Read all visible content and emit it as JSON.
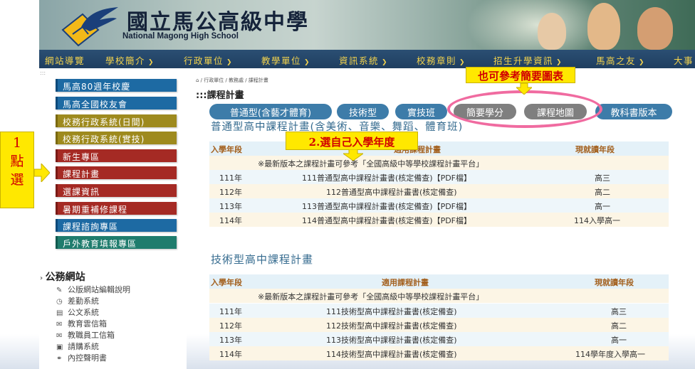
{
  "header": {
    "school_name_cn": "國立馬公高級中學",
    "school_name_en": "National Magong High School"
  },
  "nav": {
    "items": [
      {
        "label": "網站導覽"
      },
      {
        "label": "學校簡介"
      },
      {
        "label": "行政單位"
      },
      {
        "label": "教學單位"
      },
      {
        "label": "資訊系統"
      },
      {
        "label": "校務章則"
      },
      {
        "label": "招生升學資訊"
      },
      {
        "label": "馬高之友"
      },
      {
        "label": "大事"
      }
    ]
  },
  "sidebar": {
    "items": [
      {
        "label": "馬高80週年校慶"
      },
      {
        "label": "馬高全國校友會"
      },
      {
        "label": "校務行政系統(日間)"
      },
      {
        "label": "校務行政系統(實技)"
      },
      {
        "label": "新生專區"
      },
      {
        "label": "課程計畫"
      },
      {
        "label": "選課資訊"
      },
      {
        "label": "暑期重補修課程"
      },
      {
        "label": "課程諮詢專區"
      },
      {
        "label": "戶外教育填報專區"
      }
    ],
    "gov_title": "公務網站",
    "gov_links": [
      {
        "label": "公版網站編輯說明",
        "icon": "edit-icon"
      },
      {
        "label": "差勤系統",
        "icon": "clock-icon"
      },
      {
        "label": "公文系統",
        "icon": "document-icon"
      },
      {
        "label": "教育雲信箱",
        "icon": "mail-icon"
      },
      {
        "label": "教職員工信箱",
        "icon": "envelope-icon"
      },
      {
        "label": "請購系統",
        "icon": "cart-icon"
      },
      {
        "label": "內控聲明書",
        "icon": "link-icon"
      }
    ]
  },
  "main": {
    "breadcrumb": "行政單位 / 教務處 / 課程計畫",
    "page_title": ":::課程計畫",
    "pills": [
      {
        "label": "普通型(含藝才體育)"
      },
      {
        "label": "技術型"
      },
      {
        "label": "實技班"
      },
      {
        "label": "簡要學分"
      },
      {
        "label": "課程地圖"
      },
      {
        "label": "教科書版本"
      }
    ],
    "section1": {
      "title": "普通型高中課程計畫(含美術、音樂、舞蹈、體育班)",
      "headers": {
        "year": "入學年段",
        "plan": "適用課程計畫",
        "grade": "現就讀年段"
      },
      "note": "※最新版本之課程計畫可參考「全國高級中等學校課程計畫平台」",
      "rows": [
        {
          "year": "111年",
          "plan": "111普通型高中課程計畫書(核定備查)【PDF檔】",
          "grade": "高三"
        },
        {
          "year": "112年",
          "plan": "112普通型高中課程計畫書(核定備查)",
          "grade": "高二"
        },
        {
          "year": "113年",
          "plan": "113普通型高中課程計畫書(核定備查)【PDF檔】",
          "grade": "高一"
        },
        {
          "year": "114年",
          "plan": "114普通型高中課程計畫書(核定備查)【PDF檔】",
          "grade": "114入學高一"
        }
      ]
    },
    "section2": {
      "title": "技術型高中課程計畫",
      "headers": {
        "year": "入學年段",
        "plan": "適用課程計畫",
        "grade": "現就讀年段"
      },
      "note": "※最新版本之課程計畫可參考「全國高級中等學校課程計畫平台」",
      "rows": [
        {
          "year": "111年",
          "plan": "111技術型高中課程計畫書(核定備查)",
          "grade": "高三"
        },
        {
          "year": "112年",
          "plan": "112技術型高中課程計畫書(核定備查)",
          "grade": "高二"
        },
        {
          "year": "113年",
          "plan": "113技術型高中課程計畫書(核定備查)",
          "grade": "高一"
        },
        {
          "year": "114年",
          "plan": "114技術型高中課程計畫書(核定備查)",
          "grade": "114學年度入學高一"
        }
      ]
    }
  },
  "annotations": {
    "step1_num": "1",
    "step1_line1": "點",
    "step1_line2": "選",
    "step2": "2.選自己入學年度",
    "tip": "也可參考簡要圖表"
  },
  "colors": {
    "nav_bg": "#1f3e60",
    "nav_text": "#f3d34d",
    "sidebar_blue": "#1d6aa3",
    "sidebar_olive": "#9e8a1e",
    "sidebar_red": "#a52a24",
    "sidebar_teal": "#1f7c6d",
    "pill_blue": "#3d7ca9",
    "pill_gray": "#7f7f7f",
    "annotation_yellow": "#ffe800",
    "annotation_red": "#d10000",
    "oval_pink": "#f06ba0"
  }
}
